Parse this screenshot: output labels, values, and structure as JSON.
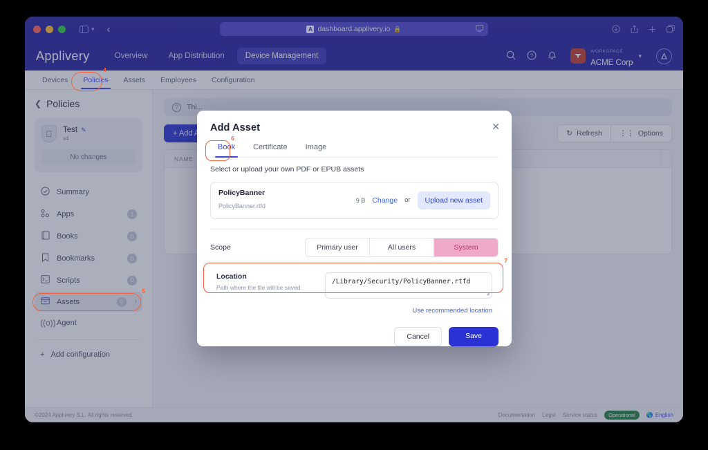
{
  "browser": {
    "address": "dashboard.applivery.io",
    "favicon": "applivery-favicon-icon",
    "lock_icon": "lock-icon",
    "back_icon": "back-arrow-icon",
    "sidebar_icon": "sidebar-toggle-icon",
    "chevron_icon": "chevron-down-icon",
    "tab_overview_icon": "screen-icon",
    "right_icons": [
      "downloads-icon",
      "share-icon",
      "new-tab-icon",
      "tab-overview-icon"
    ]
  },
  "nav": {
    "brand": "Applivery",
    "links": [
      {
        "label": "Overview",
        "active": false
      },
      {
        "label": "App Distribution",
        "active": false
      },
      {
        "label": "Device Management",
        "active": true
      }
    ],
    "icons": [
      "search-icon",
      "help-icon",
      "bell-icon"
    ],
    "workspace": {
      "label": "WORKSPACE",
      "name": "ACME Corp",
      "logo_icon": "workspace-logo-icon",
      "chevron_icon": "chevron-down-icon"
    },
    "avatar_icon": "user-avatar-icon"
  },
  "subtabs": [
    {
      "label": "Devices",
      "active": false
    },
    {
      "label": "Policies",
      "active": true
    },
    {
      "label": "Assets",
      "active": false
    },
    {
      "label": "Employees",
      "active": false
    },
    {
      "label": "Configuration",
      "active": false
    }
  ],
  "sidebar": {
    "back_label": "Policies",
    "back_icon": "chevron-left-icon",
    "policy": {
      "icon": "apple-shield-icon",
      "name": "Test",
      "edit_icon": "pencil-icon",
      "version": "v4",
      "status": "No changes"
    },
    "items": [
      {
        "label": "Summary",
        "icon": "check-circle-icon",
        "count": null,
        "selected": false,
        "chevron": false
      },
      {
        "label": "Apps",
        "icon": "apps-icon",
        "count": "1",
        "selected": false,
        "chevron": false
      },
      {
        "label": "Books",
        "icon": "book-icon",
        "count": "0",
        "selected": false,
        "chevron": false
      },
      {
        "label": "Bookmarks",
        "icon": "bookmark-icon",
        "count": "0",
        "selected": false,
        "chevron": false
      },
      {
        "label": "Scripts",
        "icon": "terminal-icon",
        "count": "0",
        "selected": false,
        "chevron": false
      },
      {
        "label": "Assets",
        "icon": "assets-box-icon",
        "count": "0",
        "selected": true,
        "chevron": true
      },
      {
        "label": "Agent",
        "icon": "agent-signal-icon",
        "count": null,
        "selected": false,
        "chevron": false
      }
    ],
    "add_configuration": "Add configuration",
    "add_icon": "plus-icon"
  },
  "main": {
    "info_text": "Thi...",
    "info_icon": "question-circle-icon",
    "add_button": "+ Add A",
    "refresh_button": "Refresh",
    "refresh_icon": "refresh-icon",
    "options_button": "Options",
    "options_icon": "sliders-icon",
    "table_header_name": "NAME"
  },
  "modal": {
    "title": "Add Asset",
    "close_icon": "close-icon",
    "tabs": [
      {
        "label": "Book",
        "active": true
      },
      {
        "label": "Certificate",
        "active": false
      },
      {
        "label": "Image",
        "active": false
      }
    ],
    "description": "Select or upload your own PDF or EPUB assets",
    "asset": {
      "name": "PolicyBanner",
      "filename": "PolicyBanner.rtfd",
      "size": "9 B",
      "change_label": "Change",
      "or_label": "or",
      "upload_label": "Upload new asset"
    },
    "scope": {
      "label": "Scope",
      "options": [
        {
          "label": "Primary user",
          "selected": false
        },
        {
          "label": "All users",
          "selected": false
        },
        {
          "label": "System",
          "selected": true
        }
      ]
    },
    "location": {
      "label": "Location",
      "hint": "Path where the file will be saved",
      "value": "/Library/Security/PolicyBanner.rtfd",
      "recommended_link": "Use recommended location"
    },
    "cancel_label": "Cancel",
    "save_label": "Save"
  },
  "footer": {
    "copyright": "©2024 Applivery S.L. All rights reserved.",
    "links": [
      "Documentation",
      "Legal",
      "Service status"
    ],
    "status": "Operational",
    "language": "English",
    "globe_icon": "globe-icon"
  },
  "annotations": [
    {
      "id": "4",
      "target": "subtab-policies"
    },
    {
      "id": "5",
      "target": "sidebar-item-assets"
    },
    {
      "id": "6",
      "target": "modal-tab-book"
    },
    {
      "id": "7",
      "target": "location-field"
    }
  ],
  "colors": {
    "brand_navy": "#221f9e",
    "accent_blue": "#3b46e2",
    "primary_button": "#2a32d4",
    "pink_selected": "#efa9c9",
    "annotation": "#f4613c",
    "status_green": "#1f7a3d"
  }
}
